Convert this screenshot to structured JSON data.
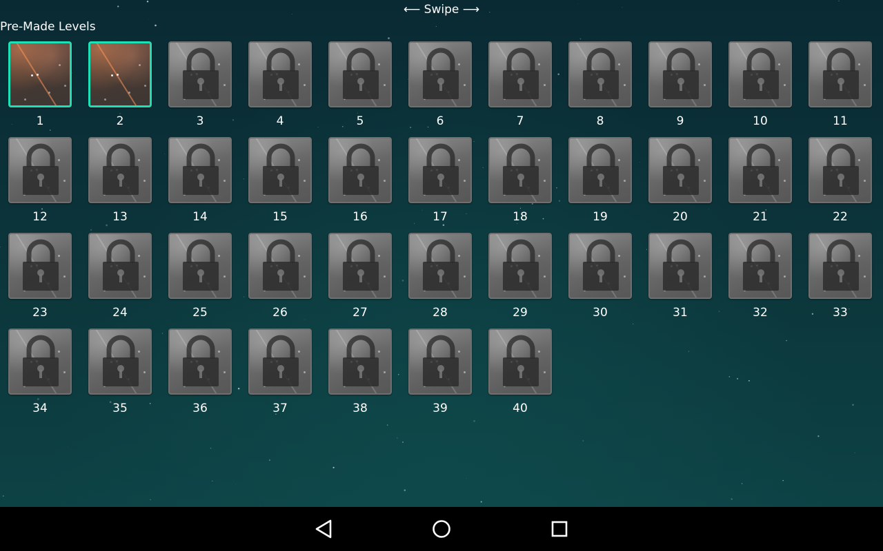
{
  "header": {
    "swipe_hint": "⟵ Swipe ⟶",
    "section_title": "Pre-Made Levels"
  },
  "levels": {
    "unlocked": [
      "1",
      "2"
    ],
    "locked": [
      "3",
      "4",
      "5",
      "6",
      "7",
      "8",
      "9",
      "10",
      "11",
      "12",
      "13",
      "14",
      "15",
      "16",
      "17",
      "18",
      "19",
      "20",
      "21",
      "22",
      "23",
      "24",
      "25",
      "26",
      "27",
      "28",
      "29",
      "30",
      "31",
      "32",
      "33",
      "34",
      "35",
      "36",
      "37",
      "38",
      "39",
      "40"
    ],
    "lock_icon": "padlock-icon"
  },
  "navbar": {
    "back_icon": "back-triangle-icon",
    "home_icon": "home-circle-icon",
    "recents_icon": "recents-square-icon"
  },
  "colors": {
    "unlocked_border": "#1de0b6",
    "locked_border": "#6f6f6f",
    "navbar_bg": "#000000"
  }
}
